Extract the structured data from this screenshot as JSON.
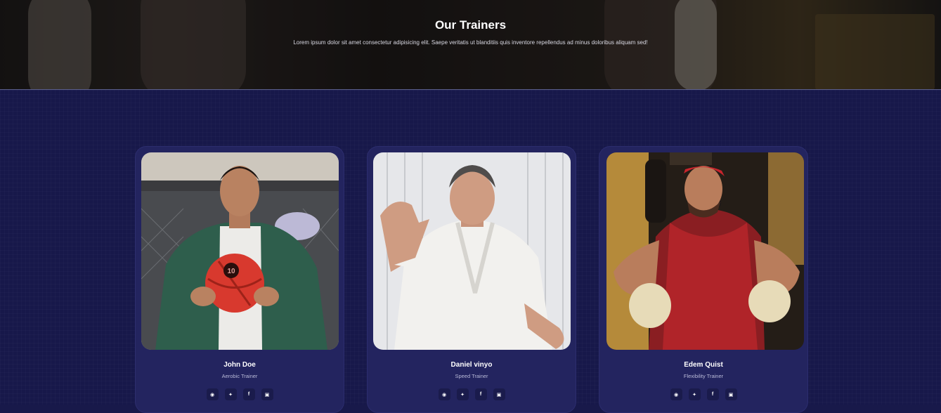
{
  "hero": {
    "title": "Our Trainers",
    "subtitle": "Lorem ipsum dolor sit amet consectetur adipisicing elit. Saepe veritatis ut blanditiis quis inventore repellendus ad minus doloribus aliquam sed!"
  },
  "trainers": [
    {
      "name": "John Doe",
      "role": "Aerobic Trainer",
      "ball_number": "10"
    },
    {
      "name": "Daniel vinyo",
      "role": "Speed Trainer"
    },
    {
      "name": "Edem Quist",
      "role": "Flexibility Trainer"
    }
  ],
  "social_icons": [
    "instagram-icon",
    "twitter-icon",
    "facebook-icon",
    "linkedin-icon"
  ],
  "colors": {
    "section_bg": "#17184a",
    "card_bg": "#23245f",
    "icon_bg": "#1a1b4c",
    "text": "#ffffff",
    "muted": "#b9bad8"
  }
}
